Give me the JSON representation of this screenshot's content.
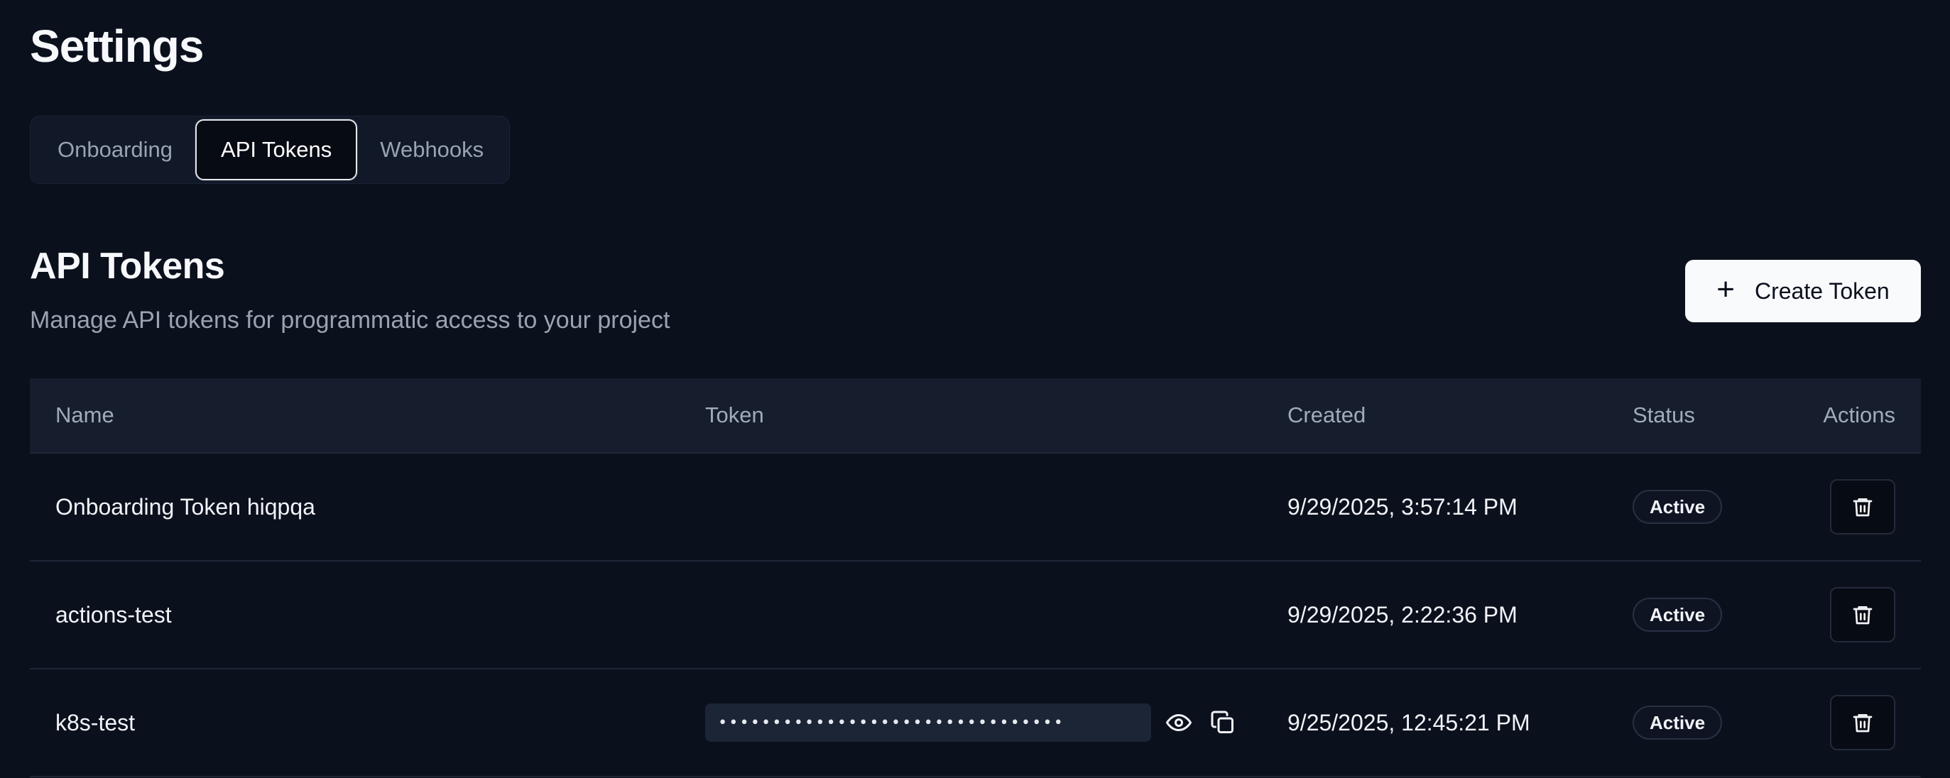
{
  "page": {
    "title": "Settings"
  },
  "tabs": [
    {
      "label": "Onboarding",
      "active": false
    },
    {
      "label": "API Tokens",
      "active": true
    },
    {
      "label": "Webhooks",
      "active": false
    }
  ],
  "section": {
    "title": "API Tokens",
    "subtitle": "Manage API tokens for programmatic access to your project",
    "create_button": {
      "label": "Create Token",
      "icon": "plus-icon"
    }
  },
  "table": {
    "columns": {
      "name": "Name",
      "token": "Token",
      "created": "Created",
      "status": "Status",
      "actions": "Actions"
    },
    "rows": [
      {
        "name": "Onboarding Token hiqpqa",
        "token": "",
        "created": "9/29/2025, 3:57:14 PM",
        "status": "Active"
      },
      {
        "name": "actions-test",
        "token": "",
        "created": "9/29/2025, 2:22:36 PM",
        "status": "Active"
      },
      {
        "name": "k8s-test",
        "token": "••••••••••••••••••••••••••••••••",
        "created": "9/25/2025, 12:45:21 PM",
        "status": "Active"
      }
    ]
  },
  "icons": {
    "delete": "trash-icon",
    "reveal": "eye-icon",
    "copy": "copy-icon"
  },
  "colors": {
    "background": "#0b101d",
    "header_row": "#161e2e",
    "muted_text": "#9aa3b2",
    "primary_button": "#f8fafc"
  }
}
